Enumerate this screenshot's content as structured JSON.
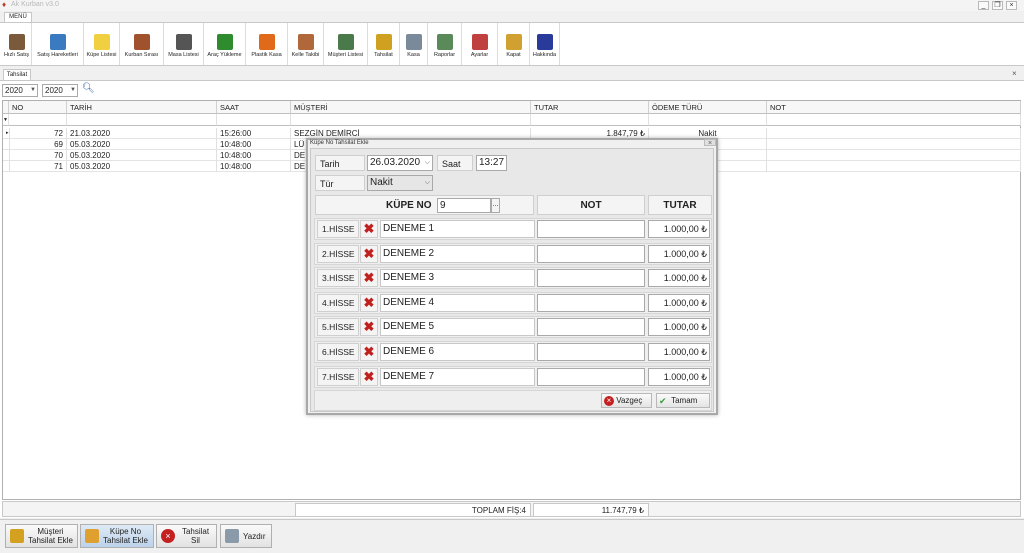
{
  "window": {
    "title": "Ak Kurban v3.0",
    "menu_tab": "MENÜ"
  },
  "ribbon": [
    {
      "label": "Hızlı Satış",
      "icon": "register-icon",
      "color": "#7a5a3a"
    },
    {
      "label": "Satış Hareketleri",
      "icon": "chart-icon",
      "color": "#3a7ac0"
    },
    {
      "label": "Küpe Listesi",
      "icon": "tag-icon",
      "color": "#f0d040"
    },
    {
      "label": "Kurban Sırası",
      "icon": "cow-icon",
      "color": "#a0522d"
    },
    {
      "label": "Masa Listesi",
      "icon": "knife-icon",
      "color": "#555555"
    },
    {
      "label": "Araç Yükleme",
      "icon": "truck-icon",
      "color": "#2e8b2e"
    },
    {
      "label": "Plastik Kasa",
      "icon": "crate-icon",
      "color": "#e06a1a"
    },
    {
      "label": "Kelle Takibi",
      "icon": "head-icon",
      "color": "#b0683a"
    },
    {
      "label": "Müşteri Listesi",
      "icon": "customers-icon",
      "color": "#4a7a4a"
    },
    {
      "label": "Tahsilat",
      "icon": "coins-icon",
      "color": "#d0a020"
    },
    {
      "label": "Kasa",
      "icon": "cash-register-icon",
      "color": "#7a8a9a"
    },
    {
      "label": "Raporlar",
      "icon": "report-icon",
      "color": "#5a8a5a"
    },
    {
      "label": "Ayarlar",
      "icon": "tools-icon",
      "color": "#c04040"
    },
    {
      "label": "Kapat",
      "icon": "exit-icon",
      "color": "#d0a030"
    },
    {
      "label": "Hakkında",
      "icon": "about-icon",
      "color": "#2a3a9a"
    }
  ],
  "document_tab": "Tahsilat",
  "filters": {
    "year_from": "2020",
    "year_to": "2020"
  },
  "grid": {
    "columns": [
      "NO",
      "TARİH",
      "SAAT",
      "MÜŞTERİ",
      "TUTAR",
      "ÖDEME TÜRÜ",
      "NOT"
    ],
    "rows": [
      {
        "no": "72",
        "date": "21.03.2020",
        "time": "15:26:00",
        "customer": "SEZGİN DEMİRCİ",
        "amount": "1.847,79 ₺",
        "payment": "Nakit",
        "note": ""
      },
      {
        "no": "69",
        "date": "05.03.2020",
        "time": "10:48:00",
        "customer": "LÜ",
        "amount": "",
        "payment": "",
        "note": ""
      },
      {
        "no": "70",
        "date": "05.03.2020",
        "time": "10:48:00",
        "customer": "DE",
        "amount": "",
        "payment": "",
        "note": ""
      },
      {
        "no": "71",
        "date": "05.03.2020",
        "time": "10:48:00",
        "customer": "DE",
        "amount": "",
        "payment": "",
        "note": ""
      }
    ],
    "footer_count": "TOPLAM FİŞ:4",
    "footer_total": "11.747,79 ₺"
  },
  "bottom_buttons": [
    {
      "label1": "Müşteri",
      "label2": "Tahsilat Ekle"
    },
    {
      "label1": "Küpe No",
      "label2": "Tahsilat Ekle"
    },
    {
      "label1": "Tahsilat Sil",
      "label2": ""
    },
    {
      "label1": "Yazdır",
      "label2": ""
    }
  ],
  "dialog": {
    "title": "Küpe No Tahsilat Ekle",
    "date_label": "Tarih",
    "date_value": "26.03.2020",
    "time_label": "Saat",
    "time_value": "13:27",
    "type_label": "Tür",
    "type_value": "Nakit",
    "kupe_label": "KÜPE NO",
    "kupe_value": "9",
    "kupe_browse": "...",
    "note_header": "NOT",
    "amount_header": "TUTAR",
    "shares": [
      {
        "label": "1.HİSSE",
        "name": "DENEME 1",
        "note": "",
        "amount": "1.000,00 ₺"
      },
      {
        "label": "2.HİSSE",
        "name": "DENEME 2",
        "note": "",
        "amount": "1.000,00 ₺"
      },
      {
        "label": "3.HİSSE",
        "name": "DENEME 3",
        "note": "",
        "amount": "1.000,00 ₺"
      },
      {
        "label": "4.HİSSE",
        "name": "DENEME 4",
        "note": "",
        "amount": "1.000,00 ₺"
      },
      {
        "label": "5.HİSSE",
        "name": "DENEME 5",
        "note": "",
        "amount": "1.000,00 ₺"
      },
      {
        "label": "6.HİSSE",
        "name": "DENEME 6",
        "note": "",
        "amount": "1.000,00 ₺"
      },
      {
        "label": "7.HİSSE",
        "name": "DENEME 7",
        "note": "",
        "amount": "1.000,00 ₺"
      }
    ],
    "cancel_label": "Vazgeç",
    "ok_label": "Tamam"
  }
}
